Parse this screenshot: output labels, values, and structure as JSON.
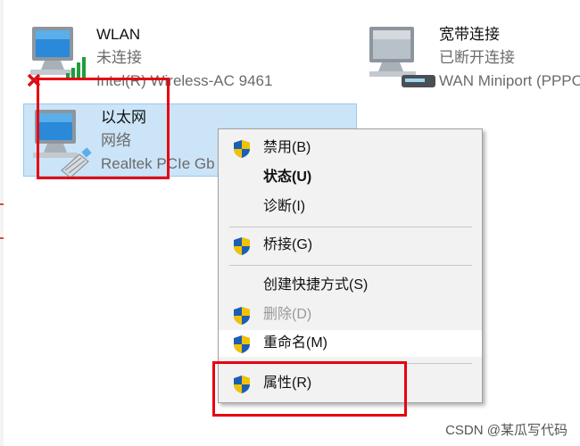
{
  "adapters": {
    "wlan": {
      "name": "WLAN",
      "status": "未连接",
      "device": "Intel(R) Wireless-AC 9461"
    },
    "ethernet": {
      "name": "以太网",
      "status": "网络",
      "device": "Realtek PCIe Gb"
    },
    "broadband": {
      "name": "宽带连接",
      "status": "已断开连接",
      "device": "WAN Miniport (PPPOE)"
    }
  },
  "context_menu": {
    "items": [
      {
        "label": "禁用(B)",
        "shield": true
      },
      {
        "label": "状态(U)",
        "bold": true
      },
      {
        "label": "诊断(I)"
      },
      {
        "label": "桥接(G)",
        "shield": true
      },
      {
        "label": "创建快捷方式(S)"
      },
      {
        "label": "删除(D)",
        "shield": true,
        "disabled": true
      },
      {
        "label": "重命名(M)",
        "shield": true,
        "hovered": true
      },
      {
        "label": "属性(R)",
        "shield": true
      }
    ]
  },
  "watermark": "CSDN @某瓜写代码",
  "colors": {
    "selection": "#cce4f7",
    "annotation_red": "#e60012",
    "shield_blue": "#1a5fb4",
    "shield_yellow": "#f2c200"
  }
}
